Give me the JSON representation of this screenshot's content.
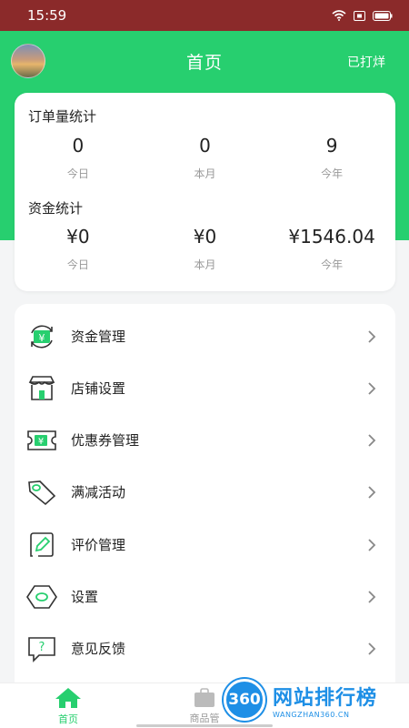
{
  "status_bar": {
    "time": "15:59"
  },
  "header": {
    "title": "首页",
    "right_action": "已打烊"
  },
  "stats": {
    "orders": {
      "title": "订单量统计",
      "items": [
        {
          "value": "0",
          "label": "今日"
        },
        {
          "value": "0",
          "label": "本月"
        },
        {
          "value": "9",
          "label": "今年"
        }
      ]
    },
    "funds": {
      "title": "资金统计",
      "items": [
        {
          "value": "¥0",
          "label": "今日"
        },
        {
          "value": "¥0",
          "label": "本月"
        },
        {
          "value": "¥1546.04",
          "label": "今年"
        }
      ]
    }
  },
  "menu": [
    {
      "label": "资金管理",
      "icon": "money-cycle-icon"
    },
    {
      "label": "店铺设置",
      "icon": "shop-icon"
    },
    {
      "label": "优惠券管理",
      "icon": "coupon-icon"
    },
    {
      "label": "满减活动",
      "icon": "tag-icon"
    },
    {
      "label": "评价管理",
      "icon": "review-edit-icon"
    },
    {
      "label": "设置",
      "icon": "settings-hex-icon"
    },
    {
      "label": "意见反馈",
      "icon": "feedback-icon"
    }
  ],
  "tabbar": [
    {
      "label": "首页",
      "icon": "home-icon",
      "active": true
    },
    {
      "label": "商品管",
      "icon": "goods-bag-icon",
      "active": false
    }
  ],
  "watermark": {
    "badge": "360",
    "title": "网站排行榜",
    "subtitle": "WANGZHAN360.CN"
  },
  "colors": {
    "accent": "#27cf6f",
    "status_bar": "#8b2a2a",
    "background": "#f4f5f6"
  }
}
